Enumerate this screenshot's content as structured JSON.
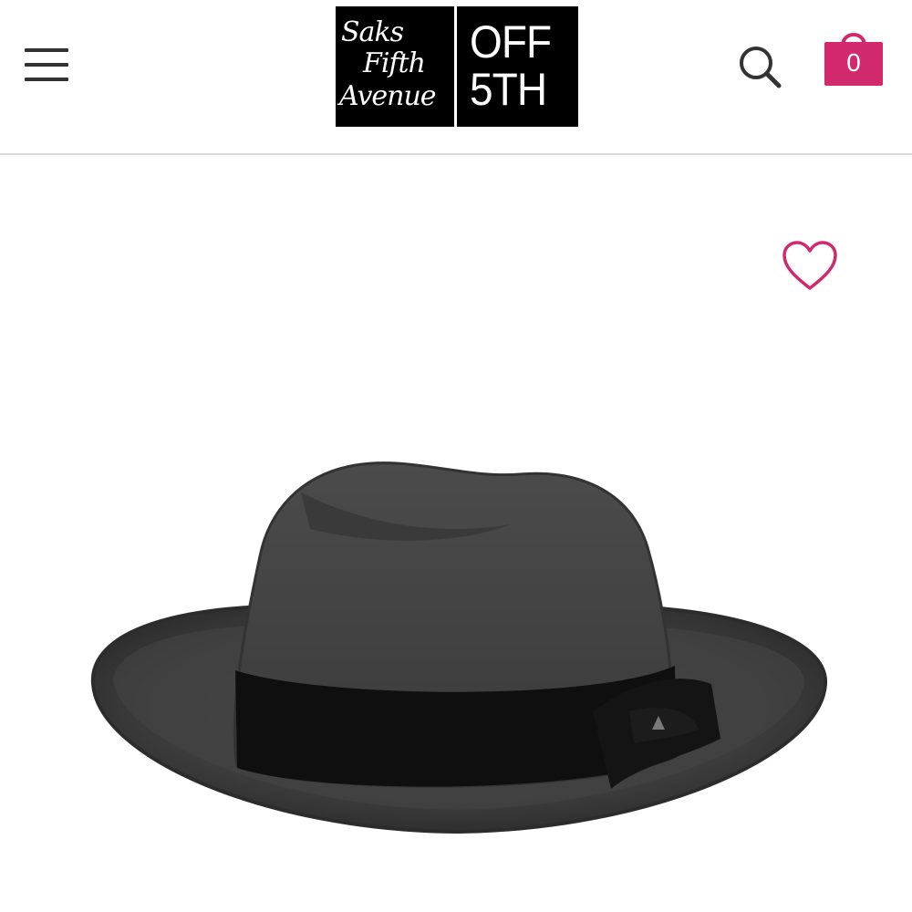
{
  "header": {
    "menu_icon": "hamburger-menu-icon",
    "logo": {
      "brand_line1": "Saks",
      "brand_line2": "Fifth",
      "brand_line3": "Avenue",
      "sub_line1": "OFF",
      "sub_line2": "5TH"
    },
    "search_icon": "search-icon",
    "cart": {
      "icon": "shopping-bag-icon",
      "count": "0"
    }
  },
  "product": {
    "favorite_icon": "heart-outline-icon",
    "image_subject": "charcoal-felt-fedora-hat"
  },
  "colors": {
    "accent": "#d2286e",
    "header_icon": "#333333",
    "logo_bg": "#000000",
    "divider": "#d9d9d9"
  }
}
